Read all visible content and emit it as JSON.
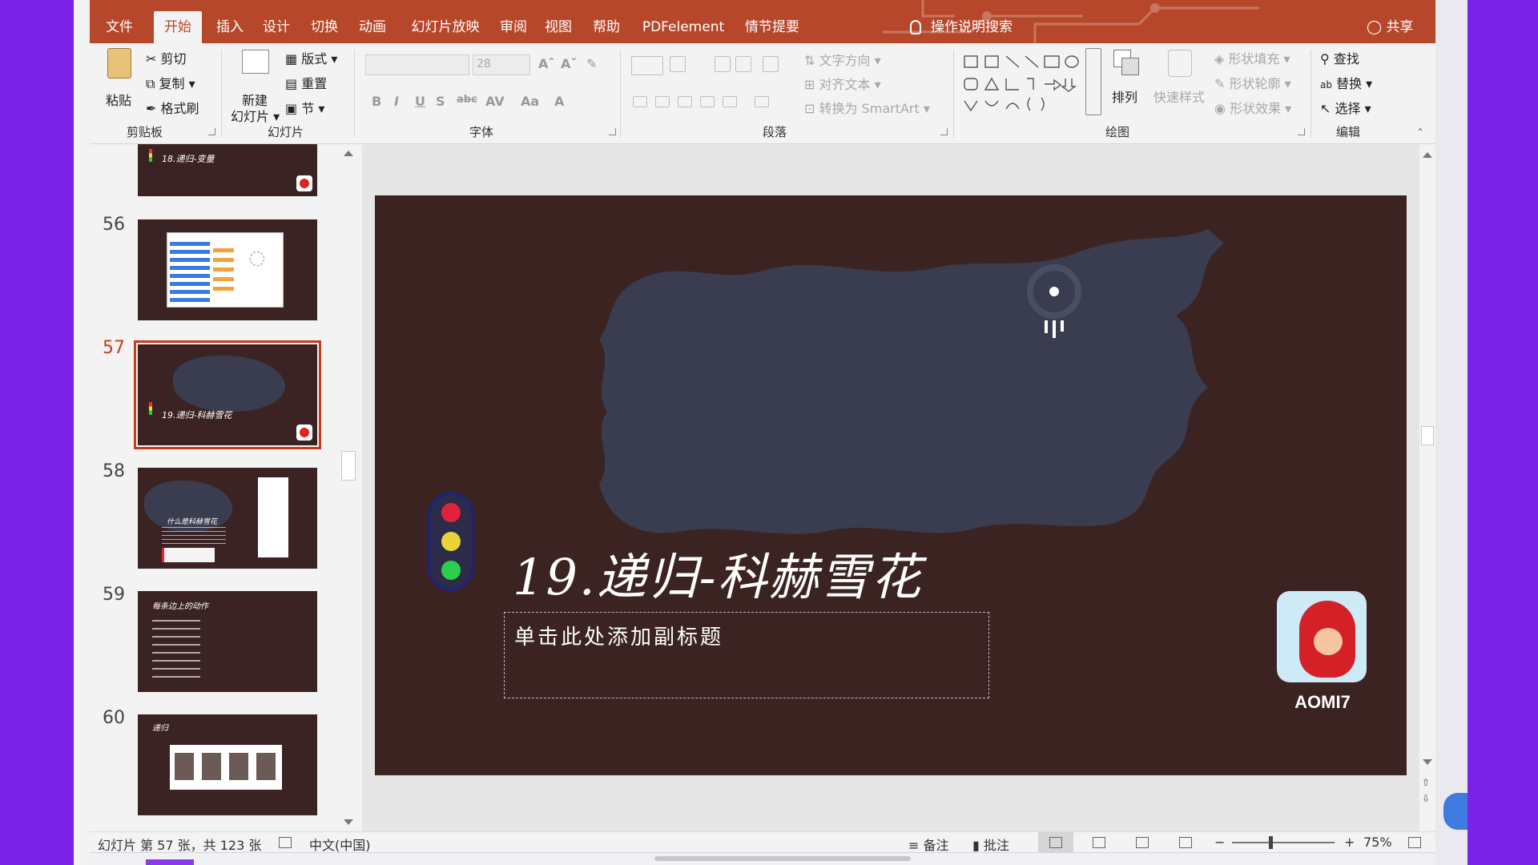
{
  "menu": {
    "tabs": [
      {
        "label": "文件",
        "active": false
      },
      {
        "label": "开始",
        "active": true
      },
      {
        "label": "插入",
        "active": false
      },
      {
        "label": "设计",
        "active": false
      },
      {
        "label": "切换",
        "active": false
      },
      {
        "label": "动画",
        "active": false
      },
      {
        "label": "幻灯片放映",
        "active": false
      },
      {
        "label": "审阅",
        "active": false
      },
      {
        "label": "视图",
        "active": false
      },
      {
        "label": "帮助",
        "active": false
      },
      {
        "label": "PDFelement",
        "active": false
      },
      {
        "label": "情节提要",
        "active": false
      }
    ],
    "tell_me": "操作说明搜索",
    "share": "共享"
  },
  "ribbon": {
    "clipboard": {
      "paste": "粘贴",
      "cut": "剪切",
      "copy": "复制",
      "format_painter": "格式刷",
      "label": "剪贴板"
    },
    "slides": {
      "new_slide_line1": "新建",
      "new_slide_line2": "幻灯片",
      "layout": "版式",
      "reset": "重置",
      "section": "节",
      "label": "幻灯片"
    },
    "font": {
      "size": "28",
      "label": "字体"
    },
    "paragraph": {
      "text_direction": "文字方向",
      "align_text": "对齐文本",
      "convert_smartart": "转换为 SmartArt",
      "label": "段落"
    },
    "drawing": {
      "arrange": "排列",
      "quick_styles": "快速样式",
      "shape_fill": "形状填充",
      "shape_outline": "形状轮廓",
      "shape_effects": "形状效果",
      "label": "绘图"
    },
    "editing": {
      "find": "查找",
      "replace": "替换",
      "select": "选择",
      "label": "编辑"
    }
  },
  "thumbnails": [
    {
      "number": "",
      "title": "18.递归-变量",
      "active": false
    },
    {
      "number": "56",
      "title": "",
      "active": false
    },
    {
      "number": "57",
      "title": "19.递归-科赫雪花",
      "active": true
    },
    {
      "number": "58",
      "title": "什么是科赫雪花",
      "active": false
    },
    {
      "number": "59",
      "title": "每条边上的动作",
      "active": false
    },
    {
      "number": "60",
      "title": "递归",
      "active": false
    }
  ],
  "slide": {
    "title": "19.递归-科赫雪花",
    "subtitle_placeholder": "单击此处添加副标题",
    "logo_text": "AOMI7",
    "background": "#3b2322",
    "brush_color": "#3a3d4f"
  },
  "status": {
    "slide_info": "幻灯片 第 57 张，共 123 张",
    "language": "中文(中国)",
    "notes": "备注",
    "comments": "批注",
    "zoom": "75%"
  },
  "colors": {
    "accent": "#b7472a",
    "active_thumb": "#c43e1c",
    "traffic_red": "#e0223a",
    "traffic_yellow": "#e8d43a",
    "traffic_green": "#2ad04a"
  }
}
